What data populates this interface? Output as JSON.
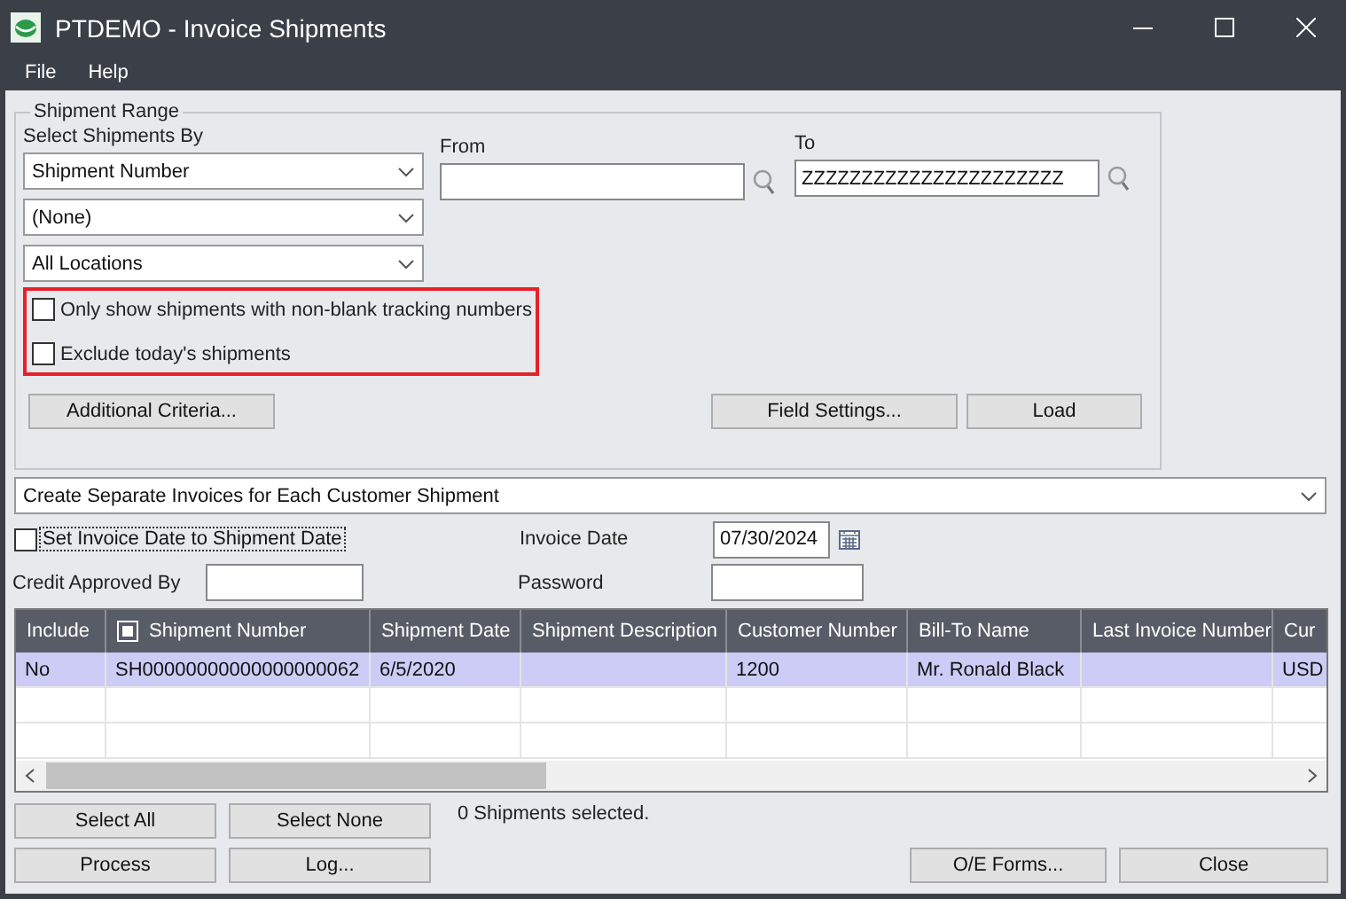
{
  "window": {
    "title": "PTDEMO - Invoice Shipments"
  },
  "menu": [
    {
      "label": "File"
    },
    {
      "label": "Help"
    }
  ],
  "shipment_range": {
    "title": "Shipment Range",
    "select_label": "Select Shipments By",
    "selects": [
      "Shipment Number",
      "(None)",
      "All Locations"
    ],
    "from": {
      "label": "From"
    },
    "to": {
      "label": "To",
      "value": "ZZZZZZZZZZZZZZZZZZZZZZ"
    },
    "filters": {
      "highlighted": true,
      "items": [
        {
          "label": "Only show shipments with non-blank tracking numbers",
          "checked": false
        },
        {
          "label": "Exclude today's shipments",
          "checked": false
        }
      ]
    },
    "buttons": [
      "Additional Criteria...",
      "Field Settings...",
      "Load"
    ]
  },
  "invoice_mode": "Create Separate Invoices for Each Customer Shipment",
  "set_date": {
    "label": "Set Invoice Date to Shipment Date",
    "checked": false
  },
  "invoice_date": {
    "label": "Invoice Date",
    "value": "07/30/2024"
  },
  "credit_approved_by": {
    "label": "Credit Approved By"
  },
  "password": {
    "label": "Password"
  },
  "table": {
    "columns": [
      {
        "label": "Include"
      },
      {
        "label": "Shipment Number",
        "icon": true
      },
      {
        "label": "Shipment Date"
      },
      {
        "label": "Shipment Description"
      },
      {
        "label": "Customer Number"
      },
      {
        "label": "Bill-To Name"
      },
      {
        "label": "Last Invoice Number"
      },
      {
        "label": "Cur"
      }
    ],
    "rows": [
      {
        "selected": true,
        "cells": [
          "No",
          "SH00000000000000000062",
          "6/5/2020",
          null,
          "1200",
          "Mr. Ronald Black",
          null,
          "USD"
        ]
      }
    ]
  },
  "selection_buttons": [
    "Select All",
    "Select None"
  ],
  "status": "0 Shipments selected.",
  "action_buttons": [
    "Process",
    "Log...",
    "O/E Forms...",
    "Close"
  ]
}
